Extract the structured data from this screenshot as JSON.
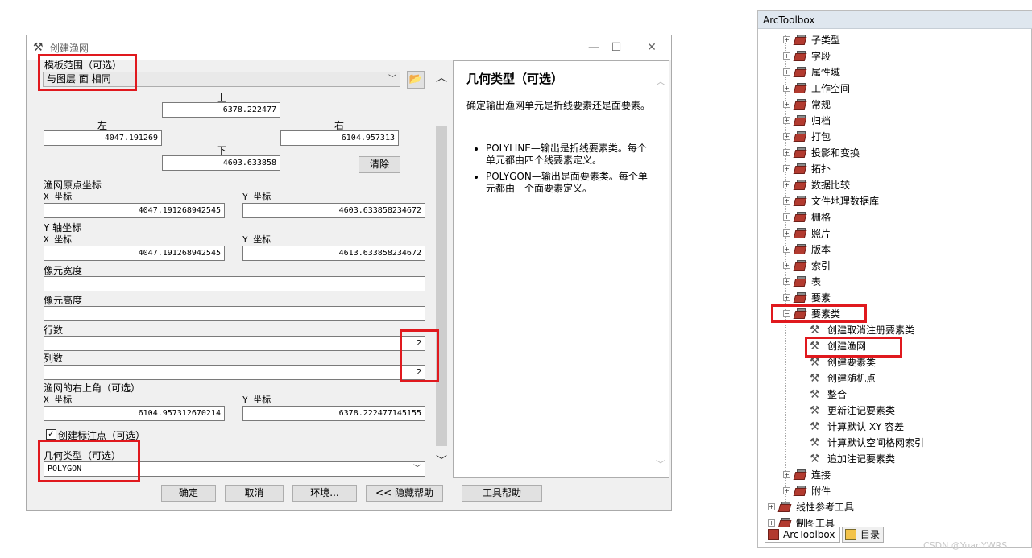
{
  "dialog": {
    "title": "创建渔网",
    "win_min": "—",
    "win_max": "☐",
    "win_close": "✕",
    "extent": {
      "label": "模板范围（可选）",
      "value": "与图层 面 相同",
      "top_label": "上",
      "top": "6378.222477",
      "left_label": "左",
      "left": "4047.191269",
      "right_label": "右",
      "right": "6104.957313",
      "bottom_label": "下",
      "bottom": "4603.633858",
      "clear_button": "清除"
    },
    "origin": {
      "label": "渔网原点坐标",
      "x_label": "X 坐标",
      "x": "4047.191268942545",
      "y_label": "Y 坐标",
      "y": "4603.633858234672"
    },
    "yaxis": {
      "label": "Y 轴坐标",
      "x_label": "X 坐标",
      "x": "4047.191268942545",
      "y_label": "Y 坐标",
      "y": "4613.633858234672"
    },
    "cell_width_label": "像元宽度",
    "cell_width": "",
    "cell_height_label": "像元高度",
    "cell_height": "",
    "rows_label": "行数",
    "rows": "2",
    "cols_label": "列数",
    "cols": "2",
    "corner": {
      "label": "渔网的右上角（可选）",
      "x_label": "X 坐标",
      "x": "6104.957312670214",
      "y_label": "Y 坐标",
      "y": "6378.222477145155"
    },
    "labels_checkbox": "创建标注点（可选）",
    "geometry_label": "几何类型（可选）",
    "geometry_value": "POLYGON",
    "buttons": {
      "ok": "确定",
      "cancel": "取消",
      "env": "环境...",
      "hide_help": "<< 隐藏帮助",
      "tool_help": "工具帮助"
    },
    "help": {
      "title": "几何类型（可选）",
      "desc": "确定输出渔网单元是折线要素还是面要素。",
      "items": [
        "POLYLINE—输出是折线要素类。每个单元都由四个线要素定义。",
        "POLYGON—输出是面要素类。每个单元都由一个面要素定义。"
      ]
    }
  },
  "toolbox": {
    "title": "ArcToolbox",
    "toolsets": [
      "子类型",
      "字段",
      "属性域",
      "工作空间",
      "常规",
      "归档",
      "打包",
      "投影和变换",
      "拓扑",
      "数据比较",
      "文件地理数据库",
      "栅格",
      "照片",
      "版本",
      "索引",
      "表",
      "要素",
      "要素类"
    ],
    "tools": [
      "创建取消注册要素类",
      "创建渔网",
      "创建要素类",
      "创建随机点",
      "整合",
      "更新注记要素类",
      "计算默认 XY 容差",
      "计算默认空间格网索引",
      "追加注记要素类"
    ],
    "after": [
      "连接",
      "附件"
    ],
    "top_level": [
      "线性参考工具",
      "制图工具"
    ],
    "tabs": [
      "ArcToolbox",
      "目录"
    ]
  },
  "watermark": "CSDN @YuanYWRS",
  "colors": {
    "highlight": "#e0191e",
    "toolbox_red": "#b23a2f"
  }
}
